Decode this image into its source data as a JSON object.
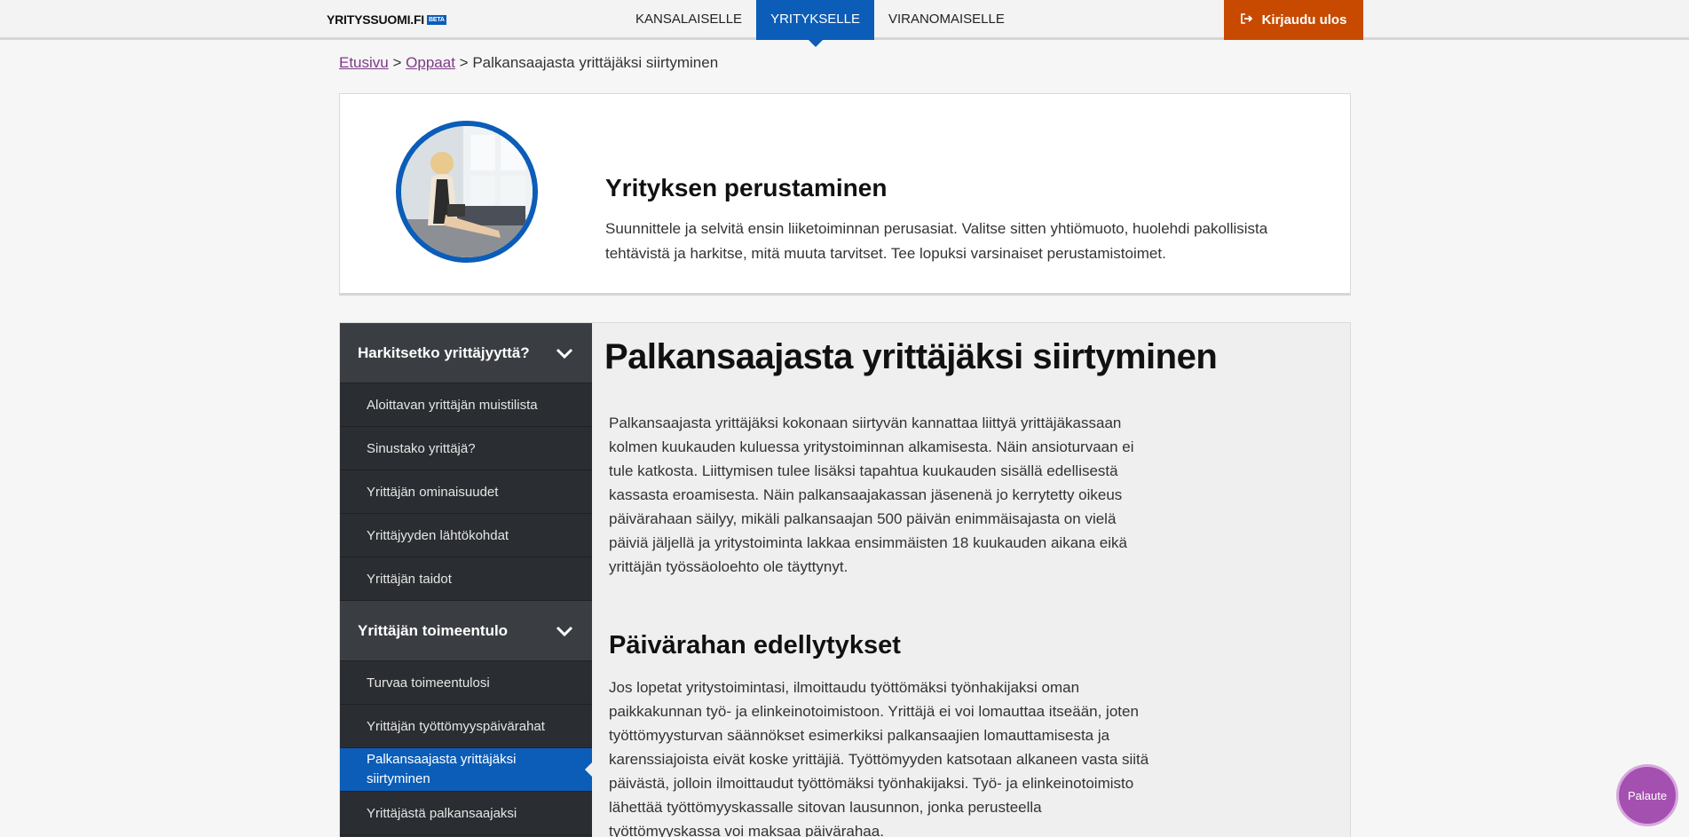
{
  "header": {
    "logo_text": "YRITYSSUOMI.FI",
    "logo_badge": "BETA",
    "tabs": [
      {
        "label": "KANSALAISELLE"
      },
      {
        "label": "YRITYKSELLE"
      },
      {
        "label": "VIRANOMAISELLE"
      }
    ],
    "active_tab": "YRITYKSELLE",
    "logout_label": "Kirjaudu ulos",
    "logout_icon": "sign-out-icon",
    "colors": {
      "primary": "#0b5db8",
      "logout": "#c84a00"
    }
  },
  "breadcrumb": {
    "home": "Etusivu",
    "guides": "Oppaat",
    "separator": ">",
    "current": "Palkansaajasta yrittäjäksi siirtyminen"
  },
  "intro": {
    "title": "Yrityksen perustaminen",
    "text": "Suunnittele ja selvitä ensin liiketoiminnan perusasiat. Valitse sitten yhtiömuoto, huolehdi pakollisista tehtävistä ja harkitse, mitä muuta tarvitset. Tee lopuksi varsinaiset perustamistoimet."
  },
  "sidebar": {
    "groups": [
      {
        "label": "Harkitsetko yrittäjyyttä?",
        "items": [
          {
            "label": "Aloittavan yrittäjän muistilista"
          },
          {
            "label": "Sinustako yrittäjä?"
          },
          {
            "label": "Yrittäjän ominaisuudet"
          },
          {
            "label": "Yrittäjyyden lähtökohdat"
          },
          {
            "label": "Yrittäjän taidot"
          }
        ]
      },
      {
        "label": "Yrittäjän toimeentulo",
        "items": [
          {
            "label": "Turvaa toimeentulosi"
          },
          {
            "label": "Yrittäjän työttömyyspäivärahat"
          },
          {
            "label": "Palkansaajasta yrittäjäksi siirtyminen"
          },
          {
            "label": "Yrittäjästä palkansaajaksi"
          }
        ]
      }
    ],
    "active_item": "Palkansaajasta yrittäjäksi siirtyminen"
  },
  "article": {
    "title": "Palkansaajasta yrittäjäksi siirtyminen",
    "paragraph1": "Palkansaajasta yrittäjäksi kokonaan siirtyvän kannattaa liittyä yrittäjäkassaan kolmen kuukauden kuluessa yritystoiminnan alkamisesta. Näin ansioturvaan ei tule katkosta. Liittymisen tulee lisäksi tapahtua kuukauden sisällä edellisestä kassasta eroamisesta. Näin palkansaajakassan jäsenenä jo kerrytetty oikeus päivärahaan säilyy, mikäli palkansaajan 500 päivän enimmäisajasta on vielä päiviä jäljellä ja yritystoiminta lakkaa ensimmäisten 18 kuukauden aikana eikä yrittäjän työssäoloehto ole täyttynyt.",
    "subheading": "Päivärahan edellytykset",
    "paragraph2": "Jos lopetat yritystoimintasi, ilmoittaudu työttömäksi työnhakijaksi oman paikkakunnan työ- ja elinkeinotoimistoon. Yrittäjä ei voi lomauttaa itseään, joten työttömyysturvan säännökset esimerkiksi palkansaajien lomauttamisesta ja karenssiajoista eivät koske yrittäjiä. Työttömyyden katsotaan alkaneen vasta siitä päivästä, jolloin ilmoittaudut työttömäksi työnhakijaksi. Työ- ja elinkeinotoimisto lähettää työttömyyskassalle sitovan lausunnon, jonka perusteella työttömyyskassa voi maksaa päivärahaa."
  },
  "feedback": {
    "label": "Palaute",
    "color": "#a450b0"
  }
}
